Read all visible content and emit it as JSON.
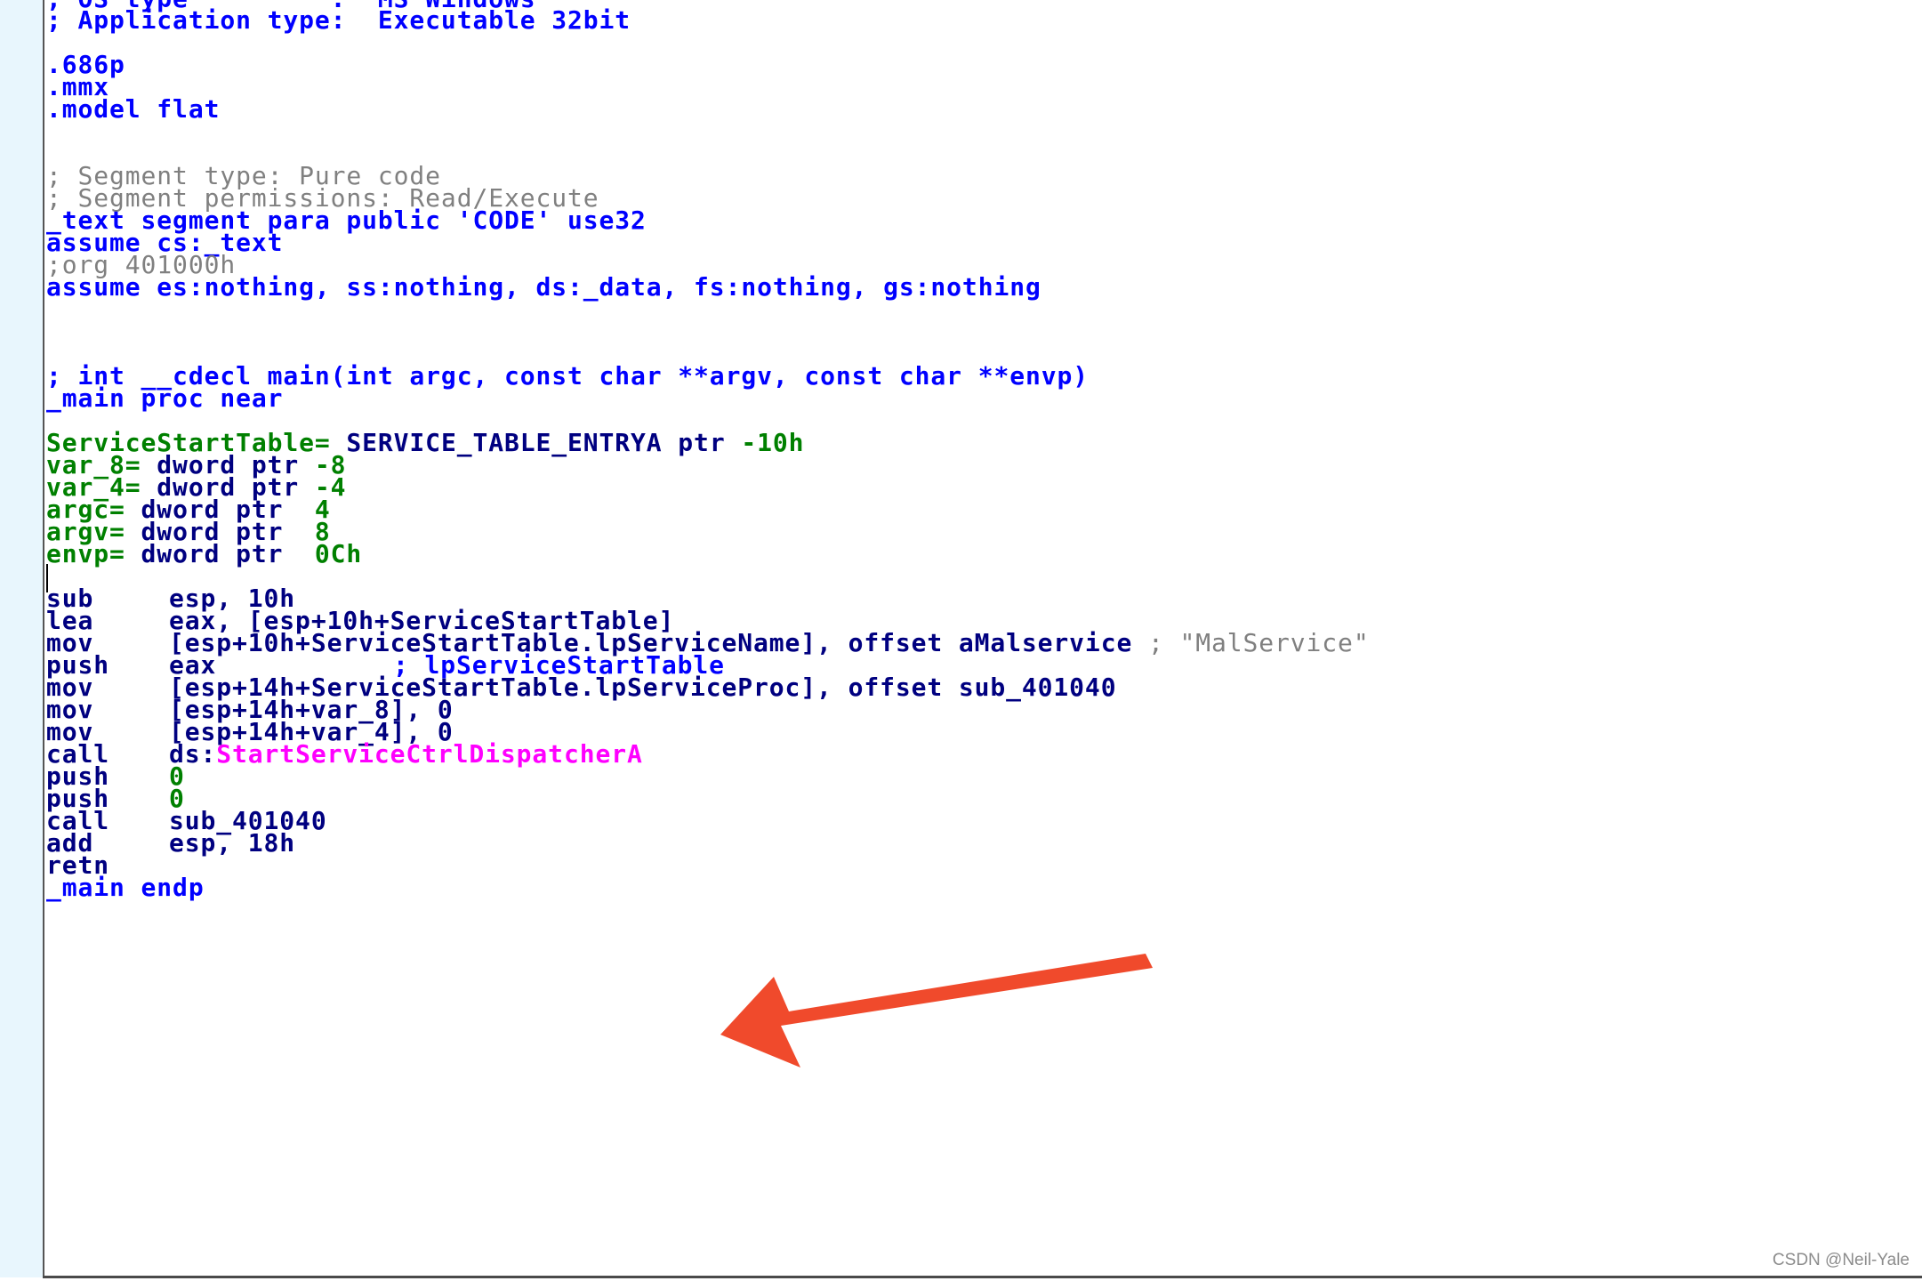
{
  "colors": {
    "directive": "#0000ff",
    "comment": "#808080",
    "variable": "#008000",
    "immediate": "#008000",
    "instruction": "#000080",
    "import": "#ff00ff",
    "annotation_arrow": "#f04a2c",
    "gutter": "#e8f6fd"
  },
  "header": {
    "os_type_partial": "; OS type         :  MS Windows",
    "app_type": "; Application type:  Executable 32bit"
  },
  "directives": {
    "cpu": ".686p",
    "mmx": ".mmx",
    "model": ".model flat"
  },
  "segment": {
    "comment_type": "; Segment type: Pure code",
    "comment_perms": "; Segment permissions: Read/Execute",
    "decl": "_text segment para public 'CODE' use32",
    "assume_cs": "assume cs:_text",
    "org": ";org 401000h",
    "assume_all": "assume es:nothing, ss:nothing, ds:_data, fs:nothing, gs:nothing"
  },
  "function": {
    "signature": "; int __cdecl main(int argc, const char **argv, const char **envp)",
    "proc": "_main proc near",
    "endp": "_main endp"
  },
  "locals": [
    {
      "name": "ServiceStartTable=",
      "type": " SERVICE_TABLE_ENTRYA ptr ",
      "offset": "-10h"
    },
    {
      "name": "var_8=",
      "type": " dword ptr ",
      "offset": "-8"
    },
    {
      "name": "var_4=",
      "type": " dword ptr ",
      "offset": "-4"
    },
    {
      "name": "argc=",
      "type": " dword ptr  ",
      "offset": "4"
    },
    {
      "name": "argv=",
      "type": " dword ptr  ",
      "offset": "8"
    },
    {
      "name": "envp=",
      "type": " dword ptr  ",
      "offset": "0Ch"
    }
  ],
  "code": [
    {
      "mnemonic": "sub",
      "operands": "esp, 10h"
    },
    {
      "mnemonic": "lea",
      "operands": "eax, [esp+10h+ServiceStartTable]"
    },
    {
      "mnemonic": "mov",
      "operands": "[esp+10h+ServiceStartTable.lpServiceName], offset aMalservice",
      "comment": "; \"MalService\""
    },
    {
      "mnemonic": "push",
      "operands": "eax",
      "comment": "; lpServiceStartTable"
    },
    {
      "mnemonic": "mov",
      "operands": "[esp+14h+ServiceStartTable.lpServiceProc], offset sub_401040"
    },
    {
      "mnemonic": "mov",
      "operands": "[esp+14h+var_8], 0"
    },
    {
      "mnemonic": "mov",
      "operands": "[esp+14h+var_4], 0"
    },
    {
      "mnemonic": "call",
      "operands_prefix": "ds:",
      "operands_import": "StartServiceCtrlDispatcherA"
    },
    {
      "mnemonic": "push",
      "operands": "0"
    },
    {
      "mnemonic": "push",
      "operands": "0"
    },
    {
      "mnemonic": "call",
      "operands": "sub_401040"
    },
    {
      "mnemonic": "add",
      "operands": "esp, 18h"
    },
    {
      "mnemonic": "retn",
      "operands": ""
    }
  ],
  "watermark": "CSDN @Neil-Yale"
}
